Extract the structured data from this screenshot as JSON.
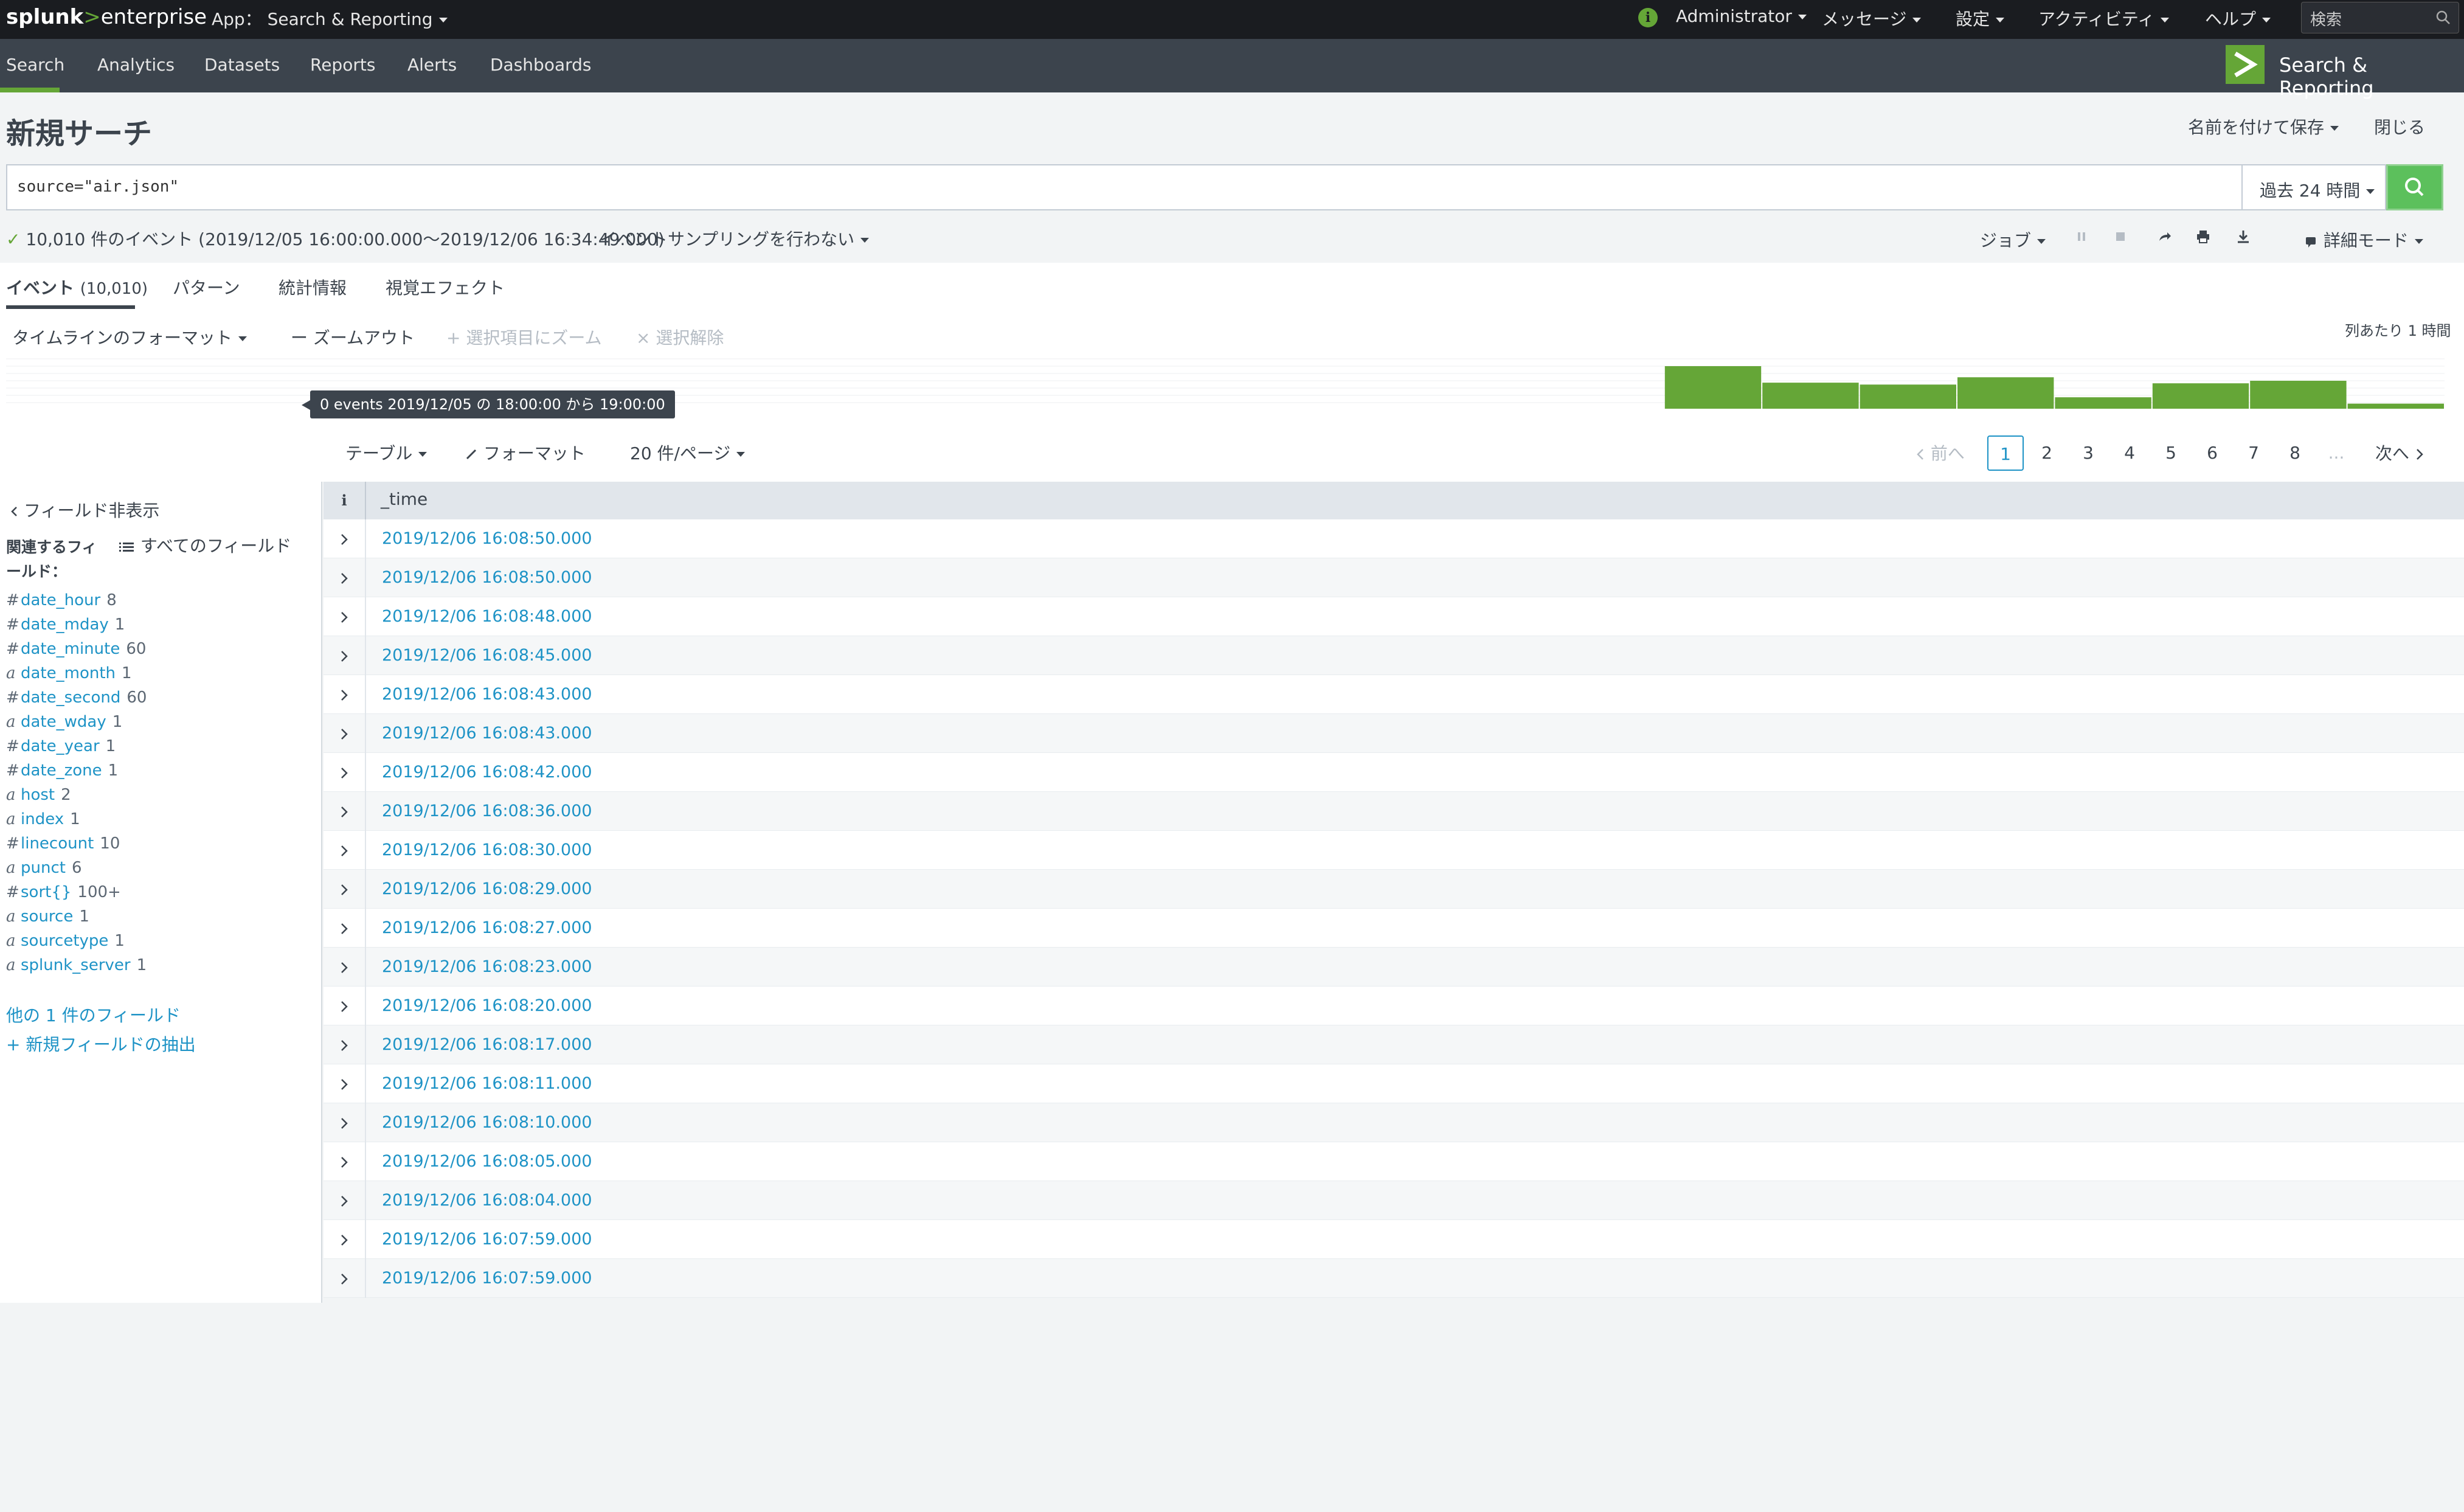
{
  "topbar": {
    "brand_main": "splunk",
    "brand_gt": ">",
    "brand_sub": "enterprise",
    "app_label": "App：",
    "app_name": "Search & Reporting",
    "admin": "Administrator",
    "messages": "メッセージ",
    "settings": "設定",
    "activity": "アクティビティ",
    "help": "ヘルプ",
    "search_placeholder": "検索",
    "info_glyph": "i"
  },
  "nav": {
    "items": [
      "Search",
      "Analytics",
      "Datasets",
      "Reports",
      "Alerts",
      "Dashboards"
    ],
    "active": "Search",
    "app_name": "Search & Reporting"
  },
  "page": {
    "title": "新規サーチ",
    "save_as": "名前を付けて保存",
    "close": "閉じる"
  },
  "search": {
    "query": "source=\"air.json\"",
    "time_range": "過去 24 時間"
  },
  "status": {
    "check": "✓",
    "summary": "10,010 件のイベント (2019/12/05 16:00:00.000〜2019/12/06 16:34:49.000)",
    "sampling": "イベントサンプリングを行わない",
    "job": "ジョブ",
    "mode": "詳細モード"
  },
  "tabs": {
    "events": "イベント",
    "events_count": "(10,010)",
    "patterns": "パターン",
    "statistics": "統計情報",
    "visualization": "視覚エフェクト"
  },
  "timeline": {
    "format": "タイムラインのフォーマット",
    "zoom_out": "ー ズームアウト",
    "zoom_selection": "+ 選択項目にズーム",
    "deselect": "× 選択解除",
    "per_column": "列あたり 1 時間",
    "tooltip": "0 events 2019/12/05 の 18:00:00 から 19:00:00",
    "bar_counts": [
      0,
      0,
      0,
      0,
      0,
      0,
      0,
      0,
      0,
      0,
      0,
      0,
      0,
      0,
      0,
      0,
      0,
      1340,
      820,
      760,
      990,
      360,
      800,
      880,
      160
    ]
  },
  "table_controls": {
    "table": "テーブル",
    "format": "フォーマット",
    "per_page": "20 件/ページ",
    "prev": "前へ",
    "next": "次へ",
    "pages": [
      "1",
      "2",
      "3",
      "4",
      "5",
      "6",
      "7",
      "8",
      "..."
    ],
    "current_page": "1"
  },
  "sidebar": {
    "hide_fields": "フィールド非表示",
    "all_fields": "すべてのフィールド",
    "related_label": "関連するフィールド：",
    "fields": [
      {
        "type": "#",
        "name": "date_hour",
        "count": "8"
      },
      {
        "type": "#",
        "name": "date_mday",
        "count": "1"
      },
      {
        "type": "#",
        "name": "date_minute",
        "count": "60"
      },
      {
        "type": "a",
        "name": "date_month",
        "count": "1"
      },
      {
        "type": "#",
        "name": "date_second",
        "count": "60"
      },
      {
        "type": "a",
        "name": "date_wday",
        "count": "1"
      },
      {
        "type": "#",
        "name": "date_year",
        "count": "1"
      },
      {
        "type": "#",
        "name": "date_zone",
        "count": "1"
      },
      {
        "type": "a",
        "name": "host",
        "count": "2"
      },
      {
        "type": "a",
        "name": "index",
        "count": "1"
      },
      {
        "type": "#",
        "name": "linecount",
        "count": "10"
      },
      {
        "type": "a",
        "name": "punct",
        "count": "6"
      },
      {
        "type": "#",
        "name": "sort{}",
        "count": "100+"
      },
      {
        "type": "a",
        "name": "source",
        "count": "1"
      },
      {
        "type": "a",
        "name": "sourcetype",
        "count": "1"
      },
      {
        "type": "a",
        "name": "splunk_server",
        "count": "1"
      }
    ],
    "other_fields": "他の 1 件のフィールド",
    "extract_fields": "+ 新規フィールドの抽出"
  },
  "events_table": {
    "info_header": "i",
    "time_header": "_time",
    "rows": [
      "2019/12/06 16:08:50.000",
      "2019/12/06 16:08:50.000",
      "2019/12/06 16:08:48.000",
      "2019/12/06 16:08:45.000",
      "2019/12/06 16:08:43.000",
      "2019/12/06 16:08:43.000",
      "2019/12/06 16:08:42.000",
      "2019/12/06 16:08:36.000",
      "2019/12/06 16:08:30.000",
      "2019/12/06 16:08:29.000",
      "2019/12/06 16:08:27.000",
      "2019/12/06 16:08:23.000",
      "2019/12/06 16:08:20.000",
      "2019/12/06 16:08:17.000",
      "2019/12/06 16:08:11.000",
      "2019/12/06 16:08:10.000",
      "2019/12/06 16:08:05.000",
      "2019/12/06 16:08:04.000",
      "2019/12/06 16:07:59.000",
      "2019/12/06 16:07:59.000"
    ]
  },
  "colors": {
    "accent": "#65a637",
    "link": "#1e93c6",
    "topbar": "#1a1c20",
    "navbar": "#3c444d"
  }
}
